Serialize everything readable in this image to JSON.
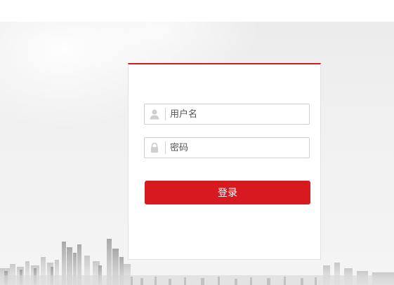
{
  "login": {
    "username_placeholder": "用户名",
    "password_placeholder": "密码",
    "submit_label": "登录"
  },
  "colors": {
    "accent": "#d71920",
    "field_border": "#cfcfcf",
    "background": "#f1f1f1"
  },
  "icons": {
    "username": "user-icon",
    "password": "lock-icon"
  }
}
